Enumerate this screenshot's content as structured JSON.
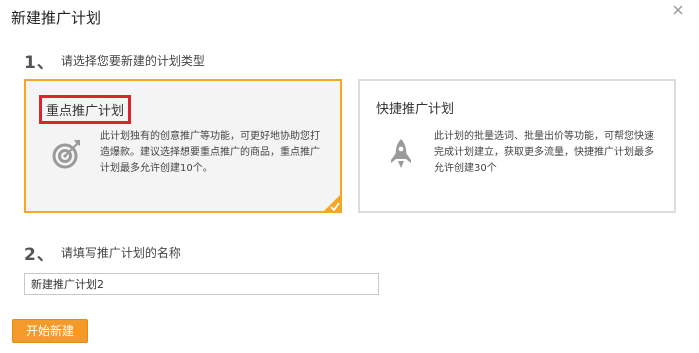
{
  "dialog": {
    "title": "新建推广计划"
  },
  "step1": {
    "number": "1、",
    "label": "请选择您要新建的计划类型"
  },
  "plans": [
    {
      "title": "重点推广计划",
      "description": "此计划独有的创意推广等功能，可更好地协助您打造爆款。建议选择想要重点推广的商品，重点推广计划最多允许创建10个。",
      "icon": "target-icon",
      "selected": true
    },
    {
      "title": "快捷推广计划",
      "description": "此计划的批量选词、批量出价等功能，可帮您快速完成计划建立，获取更多流量，快捷推广计划最多允许创建30个",
      "icon": "rocket-icon",
      "selected": false
    }
  ],
  "step2": {
    "number": "2、",
    "label": "请填写推广计划的名称"
  },
  "plan_name": {
    "value": "新建推广计划2"
  },
  "actions": {
    "start_label": "开始新建"
  },
  "colors": {
    "accent": "#f29b2a",
    "selected_border": "#f5a623",
    "highlight_box": "#d9262c"
  }
}
